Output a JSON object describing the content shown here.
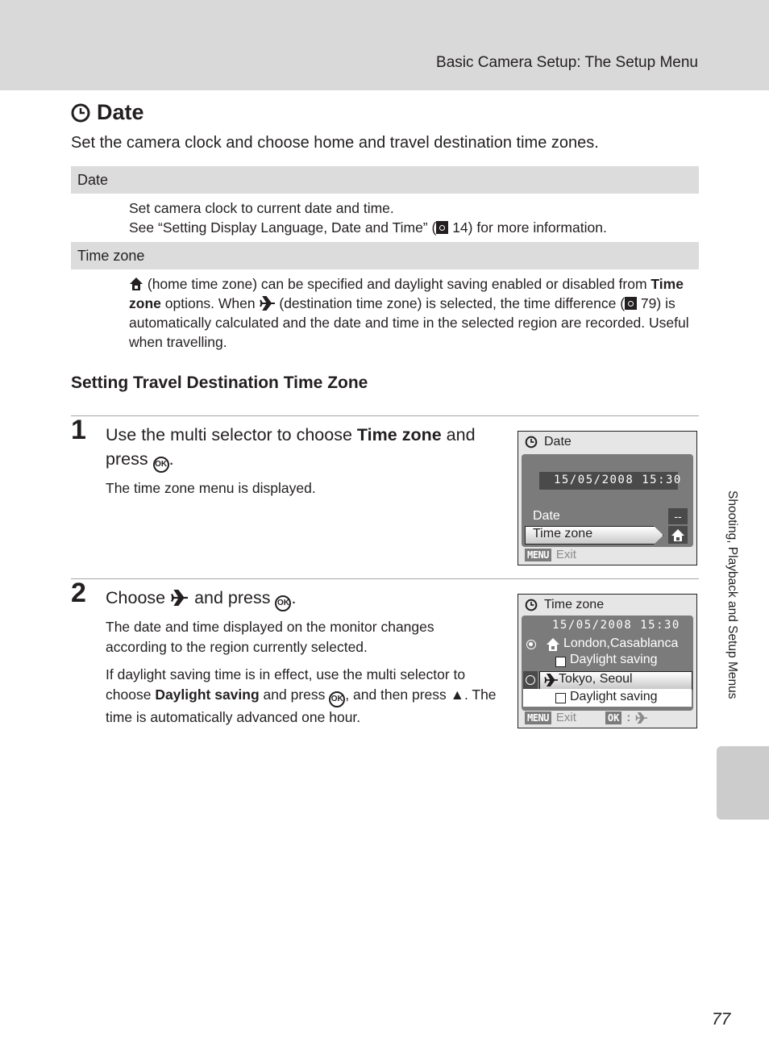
{
  "header": {
    "title": "Basic Camera Setup: The Setup Menu"
  },
  "section": {
    "icon": "clock-icon",
    "title": "Date",
    "intro": "Set the camera clock and choose home and travel destination time zones."
  },
  "options": [
    {
      "label": "Date",
      "lines": [
        "Set camera clock to current date and time.",
        "See “Setting Display Language, Date and Time” (",
        "14) for more information."
      ]
    },
    {
      "label": "Time zone",
      "text_1": "(home time zone) can be specified and daylight saving enabled or disabled from",
      "bold_1": "Time zone",
      "text_2": "options. When",
      "text_3": "(destination time zone) is selected, the time",
      "text_4": "difference (",
      "text_5": "79) is automatically calculated and the date and time in the selected",
      "text_6": "region are recorded. Useful when travelling."
    }
  ],
  "subheading": "Setting Travel Destination Time Zone",
  "steps": [
    {
      "number": "1",
      "head_pre": "Use the multi selector to choose",
      "head_bold": "Time zone",
      "head_post": "and press",
      "body": "The time zone menu is displayed."
    },
    {
      "number": "2",
      "head_pre": "Choose",
      "head_mid": "and press",
      "body_1": "The date and time displayed on the monitor changes according to the region currently selected.",
      "body_2_pre": "If daylight saving time is in effect, use the multi selector to choose",
      "body_2_bold": "Daylight saving",
      "body_2_mid": "and press",
      "body_2_post": ", and then press",
      "body_2_end": ". The time is automatically advanced one hour."
    }
  ],
  "screen1": {
    "title": "Date",
    "datetime": "15/05/2008  15:30",
    "items": [
      {
        "label": "Date",
        "value": "--"
      },
      {
        "label": "Time zone",
        "value_icon": "home-icon",
        "selected": true
      }
    ],
    "footer_key": "MENU",
    "footer_label": "Exit"
  },
  "screen2": {
    "title": "Time zone",
    "datetime": "15/05/2008  15:30",
    "home_city": "London,Casablanca",
    "home_daylight": "Daylight saving",
    "dest_city": "Tokyo, Seoul",
    "dest_daylight": "Daylight saving",
    "footer_key": "MENU",
    "footer_label": "Exit",
    "footer_ok": "OK"
  },
  "ok_symbol": "OK",
  "side_tab": {
    "label": "Shooting, Playback and Setup Menus"
  },
  "page_number": "77"
}
